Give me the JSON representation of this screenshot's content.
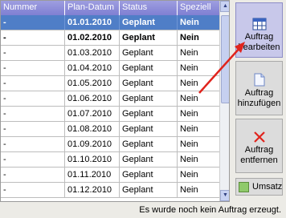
{
  "table": {
    "columns": [
      "Nummer",
      "Plan-Datum",
      "Status",
      "Speziell"
    ],
    "rows": [
      {
        "nummer": "-",
        "datum": "01.01.2010",
        "status": "Geplant",
        "speziell": "Nein"
      },
      {
        "nummer": "-",
        "datum": "01.02.2010",
        "status": "Geplant",
        "speziell": "Nein"
      },
      {
        "nummer": "-",
        "datum": "01.03.2010",
        "status": "Geplant",
        "speziell": "Nein"
      },
      {
        "nummer": "-",
        "datum": "01.04.2010",
        "status": "Geplant",
        "speziell": "Nein"
      },
      {
        "nummer": "-",
        "datum": "01.05.2010",
        "status": "Geplant",
        "speziell": "Nein"
      },
      {
        "nummer": "-",
        "datum": "01.06.2010",
        "status": "Geplant",
        "speziell": "Nein"
      },
      {
        "nummer": "-",
        "datum": "01.07.2010",
        "status": "Geplant",
        "speziell": "Nein"
      },
      {
        "nummer": "-",
        "datum": "01.08.2010",
        "status": "Geplant",
        "speziell": "Nein"
      },
      {
        "nummer": "-",
        "datum": "01.09.2010",
        "status": "Geplant",
        "speziell": "Nein"
      },
      {
        "nummer": "-",
        "datum": "01.10.2010",
        "status": "Geplant",
        "speziell": "Nein"
      },
      {
        "nummer": "-",
        "datum": "01.11.2010",
        "status": "Geplant",
        "speziell": "Nein"
      },
      {
        "nummer": "-",
        "datum": "01.12.2010",
        "status": "Geplant",
        "speziell": "Nein"
      }
    ],
    "selected_row": 0,
    "bold_rows": [
      0,
      1
    ]
  },
  "buttons": {
    "edit": {
      "line1": "Auftrag",
      "line2": "bearbeiten",
      "icon": "table-grid-icon"
    },
    "add": {
      "line1": "Auftrag",
      "line2": "hinzufügen",
      "icon": "document-icon"
    },
    "remove": {
      "line1": "Auftrag",
      "line2": "entfernen",
      "icon": "red-x-icon"
    },
    "umsatz": {
      "label": "Umsatz",
      "icon": "green-square-icon"
    }
  },
  "status_text": "Es wurde noch kein Auftrag erzeugt.",
  "colors": {
    "header_bg": "#8a8ad8",
    "selected_row": "#4f7ec7",
    "remove_x": "#e0241d",
    "umsatz_swatch": "#8fca6a",
    "arrow": "#e0241d"
  }
}
